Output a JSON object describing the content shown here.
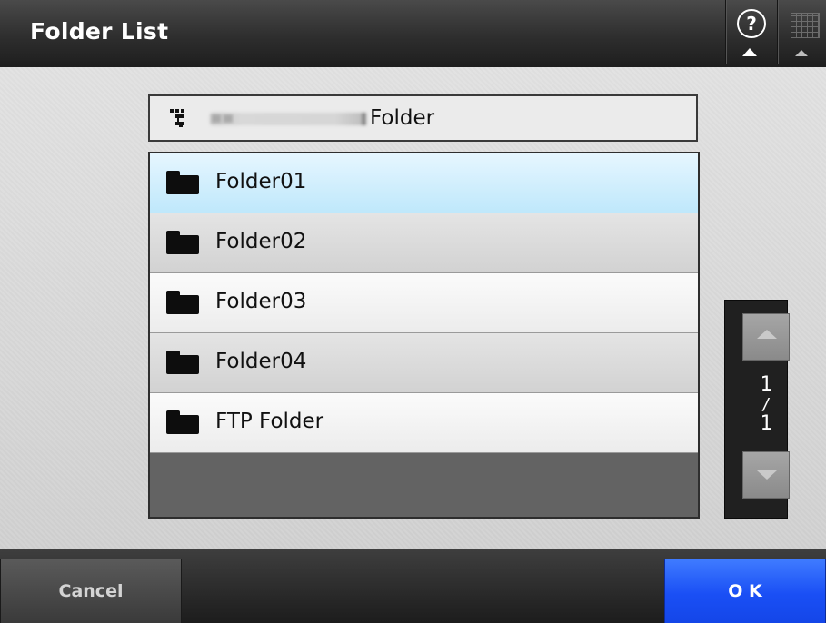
{
  "header": {
    "title": "Folder List",
    "help_icon": "question-circle-icon",
    "help_glyph": "?",
    "keyboard_icon": "keyboard-icon"
  },
  "path_bar": {
    "icon": "network-tree-icon",
    "folder_name": "Folder"
  },
  "folders": [
    {
      "label": "Folder01",
      "icon": "folder-icon",
      "selected": true
    },
    {
      "label": "Folder02",
      "icon": "folder-icon",
      "selected": false
    },
    {
      "label": "Folder03",
      "icon": "folder-icon",
      "selected": false
    },
    {
      "label": "Folder04",
      "icon": "folder-icon",
      "selected": false
    },
    {
      "label": "FTP Folder",
      "icon": "folder-icon",
      "selected": false
    }
  ],
  "pager": {
    "current": "1",
    "separator": "/",
    "total": "1",
    "up_icon": "chevron-up-icon",
    "down_icon": "chevron-down-icon"
  },
  "footer": {
    "cancel_label": "Cancel",
    "ok_label": "O K"
  },
  "colors": {
    "selected_row": "#c8ebfb",
    "ok_button": "#1a4ff5",
    "header_bg": "#2e2e2e"
  }
}
